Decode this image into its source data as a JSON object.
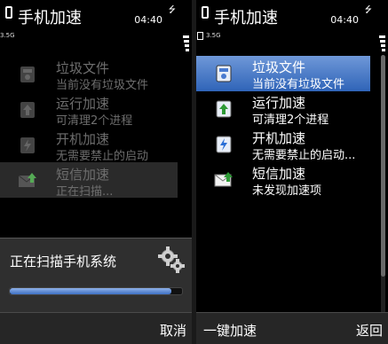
{
  "left": {
    "title": "手机加速",
    "time": "04:40",
    "network": "3.5G",
    "items": [
      {
        "label": "垃圾文件",
        "sub": "当前没有垃圾文件"
      },
      {
        "label": "运行加速",
        "sub": "可清理2个进程"
      },
      {
        "label": "开机加速",
        "sub": "无需要禁止的启动"
      },
      {
        "label": "短信加速",
        "sub": "正在扫描..."
      }
    ],
    "dialog": {
      "message": "正在扫描手机系统",
      "progress": 0.94
    },
    "softkeys": {
      "right": "取消"
    }
  },
  "right": {
    "title": "手机加速",
    "time": "04:40",
    "network": "3.5G",
    "items": [
      {
        "label": "垃圾文件",
        "sub": "当前没有垃圾文件"
      },
      {
        "label": "运行加速",
        "sub": "可清理2个进程"
      },
      {
        "label": "开机加速",
        "sub": "无需要禁止的启动..."
      },
      {
        "label": "短信加速",
        "sub": "未发现加速项"
      }
    ],
    "softkeys": {
      "left": "一键加速",
      "right": "返回"
    }
  },
  "colors": {
    "selection": "#2f64b8",
    "progress": "#3d6fc2"
  }
}
